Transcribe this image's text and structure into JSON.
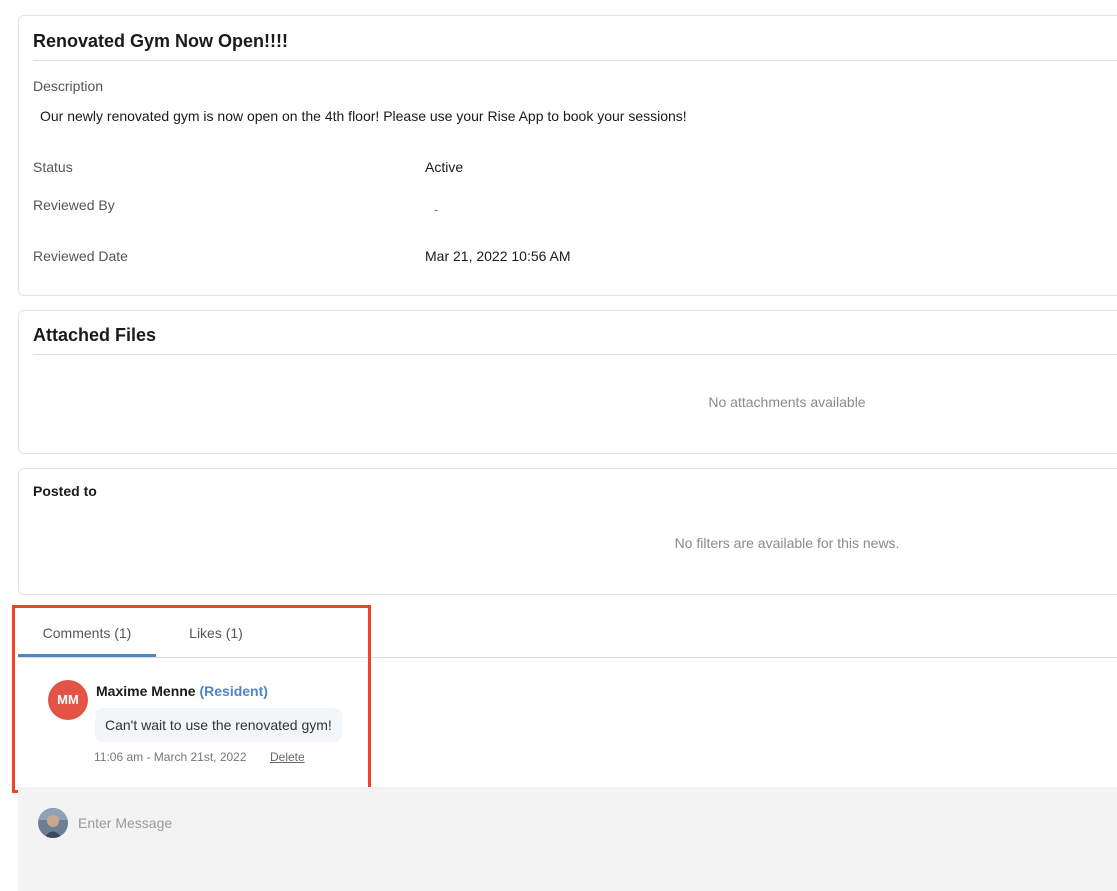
{
  "news": {
    "title": "Renovated Gym Now Open!!!!",
    "description_label": "Description",
    "description": "Our newly renovated gym is now open on the 4th floor! Please use your Rise App to book your sessions!",
    "status_label": "Status",
    "status": "Active",
    "reviewed_by_label": "Reviewed By",
    "reviewed_by": "-",
    "reviewed_date_label": "Reviewed Date",
    "reviewed_date": "Mar 21, 2022 10:56 AM"
  },
  "attachments": {
    "title": "Attached Files",
    "empty": "No attachments available"
  },
  "posted_to": {
    "title": "Posted to",
    "empty": "No filters are available for this news."
  },
  "tabs": [
    {
      "label": "Comments (1)",
      "active": true
    },
    {
      "label": "Likes (1)",
      "active": false
    }
  ],
  "comments": [
    {
      "initials": "MM",
      "author": "Maxime Menne",
      "role": "(Resident)",
      "text": "Can't wait to use the renovated gym!",
      "time": "11:06 am - March 21st, 2022",
      "delete_label": "Delete"
    }
  ],
  "composer": {
    "placeholder": "Enter Message"
  },
  "colors": {
    "accent": "#4a86c8",
    "avatar_bg": "#e35446",
    "highlight": "#f0412b"
  }
}
